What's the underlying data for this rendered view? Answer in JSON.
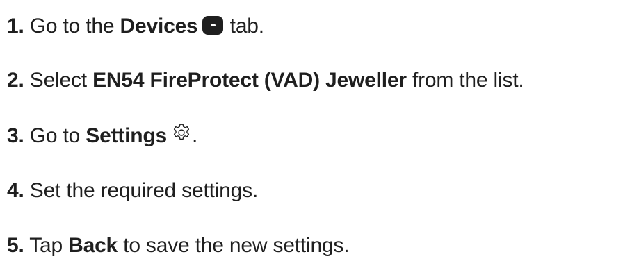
{
  "steps": [
    {
      "num": "1.",
      "pre": " Go to the ",
      "bold": "Devices",
      "post": " tab.",
      "icon": "devices-icon"
    },
    {
      "num": "2.",
      "pre": " Select ",
      "bold": "EN54 FireProtect (VAD) Jeweller",
      "post": " from the list."
    },
    {
      "num": "3.",
      "pre": " Go to ",
      "bold": "Settings",
      "post": ".",
      "icon": "gear-icon"
    },
    {
      "num": "4.",
      "text": " Set the required settings."
    },
    {
      "num": "5.",
      "pre": " Tap ",
      "bold": "Back",
      "post": " to save the new settings."
    }
  ],
  "colors": {
    "text": "#1f1f1f",
    "background": "#ffffff"
  }
}
